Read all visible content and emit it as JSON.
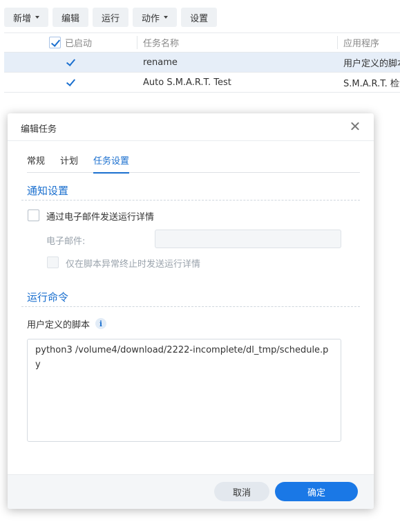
{
  "toolbar": {
    "create": "新增",
    "edit": "编辑",
    "run": "运行",
    "action": "动作",
    "settings": "设置"
  },
  "table": {
    "headers": {
      "enabled": "已启动",
      "task_name": "任务名称",
      "application": "应用程序"
    },
    "rows": [
      {
        "enabled": true,
        "name": "rename",
        "app": "用户定义的脚本"
      },
      {
        "enabled": true,
        "name": "Auto S.M.A.R.T. Test",
        "app": "S.M.A.R.T. 检测"
      }
    ]
  },
  "dialog": {
    "title": "编辑任务",
    "tabs": [
      "常规",
      "计划",
      "任务设置"
    ],
    "active_tab": "任务设置",
    "notification": {
      "section_title": "通知设置",
      "email_checkbox_label": "通过电子邮件发送运行详情",
      "email_checked": false,
      "email_label": "电子邮件:",
      "email_value": "",
      "abnormal_only_label": "仅在脚本异常终止时发送运行详情",
      "abnormal_only_checked": false
    },
    "command": {
      "section_title": "运行命令",
      "script_label": "用户定义的脚本",
      "script": "python3 /volume4/download/2222-incomplete/dl_tmp/schedule.py"
    },
    "buttons": {
      "cancel": "取消",
      "ok": "确定"
    }
  },
  "colors": {
    "accent": "#1a6fcf",
    "primary_button": "#1a78e6"
  }
}
